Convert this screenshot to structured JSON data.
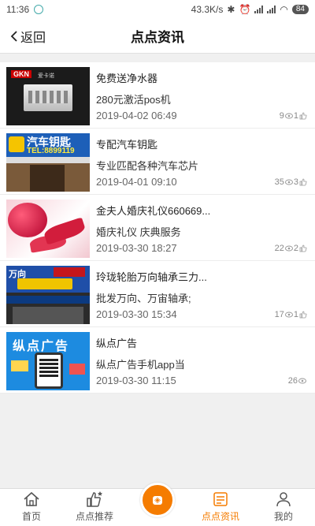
{
  "statusbar": {
    "time": "11:36",
    "network_speed": "43.3K/s",
    "battery": "84"
  },
  "header": {
    "back_label": "返回",
    "title": "点点资讯"
  },
  "items": [
    {
      "title": "免费送净水器",
      "subtitle": "280元激活pos机",
      "date": "2019-04-02 06:49",
      "views": "9",
      "likes": "1",
      "thumb_brand": "GKN",
      "thumb_tag": "爱卡诺"
    },
    {
      "title": "专配汽车钥匙",
      "subtitle": "专业匹配各种汽车芯片",
      "date": "2019-04-01 09:10",
      "views": "35",
      "likes": "3",
      "thumb_big": "汽车钥匙",
      "thumb_tel": "TEL:8899119"
    },
    {
      "title": "金夫人婚庆礼仪660669...",
      "subtitle": "婚庆礼仪 庆典服务",
      "date": "2019-03-30 18:27",
      "views": "22",
      "likes": "2"
    },
    {
      "title": "玲珑轮胎万向轴承三力...",
      "subtitle": "批发万向、万宙轴承;",
      "date": "2019-03-30 15:34",
      "views": "17",
      "likes": "1",
      "thumb_label": "万向"
    },
    {
      "title": "纵点广告",
      "subtitle": "纵点广告手机app当",
      "date": "2019-03-30 11:15",
      "views": "26",
      "likes": "",
      "thumb_header": "纵点广告"
    }
  ],
  "bottomnav": {
    "tabs": [
      {
        "label": "首页",
        "icon": "home-icon"
      },
      {
        "label": "点点推荐",
        "icon": "thumbs-up-star-icon"
      },
      {
        "label": "",
        "icon": "center-logo-icon"
      },
      {
        "label": "点点资讯",
        "icon": "news-icon"
      },
      {
        "label": "我的",
        "icon": "user-icon"
      }
    ],
    "active_color": "#f57c00"
  }
}
